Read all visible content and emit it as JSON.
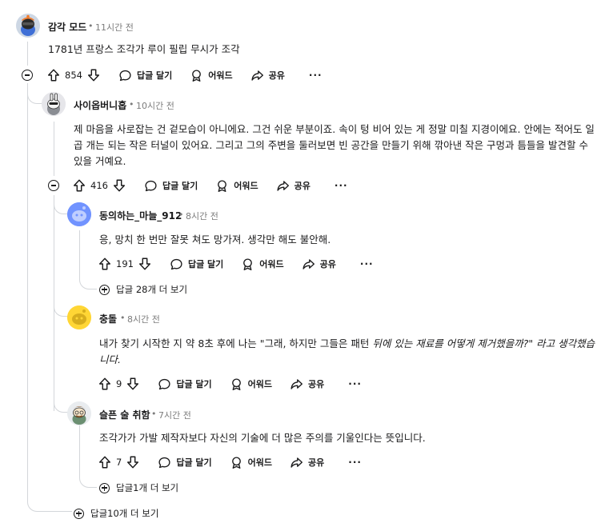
{
  "comments": [
    {
      "author": "감각 모드",
      "time": "11시간 전",
      "body": "1781년 프랑스 조각가 루이 필립 무시가 조각",
      "votes": "854",
      "actions": {
        "reply": "답글 달기",
        "award": "어워드",
        "share": "공유",
        "more": "···"
      }
    },
    {
      "author": "사이옵버니홉",
      "time": "10시간 전",
      "body": "제 마음을 사로잡는 건 겉모습이 아니에요. 그건 쉬운 부분이죠. 속이 텅 비어 있는 게 정말 미칠 지경이에요. 안에는 적어도 일곱 개는 되는 작은 터널이 있어요. 그리고 그의 주변을 둘러보면 빈 공간을 만들기 위해 깎아낸 작은 구멍과 틈들을 발견할 수 있을 거예요.",
      "votes": "416",
      "actions": {
        "reply": "답글 달기",
        "award": "어워드",
        "share": "공유",
        "more": "···"
      }
    },
    {
      "author": "동의하는_마늘_912",
      "time": "8시간 전",
      "body": "응, 망치 한 번만 잘못 쳐도 망가져. 생각만 해도 불안해.",
      "votes": "191",
      "actions": {
        "reply": "답글 달기",
        "award": "어워드",
        "share": "공유",
        "more": "···"
      },
      "more_replies": "답글 28개 더 보기"
    },
    {
      "author": "충돌",
      "time": "8시간 전",
      "body_prefix": "내가 찾기 시작한 지 약 8초 후에 나는 \"그래, 하지만 그들은 패턴 ",
      "body_italic": "뒤에 있는 재료를 어떻게 제거했을까?\" 라고 생각했습니다.",
      "votes": "9",
      "actions": {
        "reply": "답글 달기",
        "award": "어워드",
        "share": "공유",
        "more": "···"
      }
    },
    {
      "author": "슬픈 술 취함",
      "time": "7시간 전",
      "body": "조각가가 가발 제작자보다 자신의 기술에 더 많은 주의를 기울인다는 뜻입니다.",
      "votes": "7",
      "actions": {
        "reply": "답글 달기",
        "award": "어워드",
        "share": "공유",
        "more": "···"
      },
      "more_replies": "답글1개 더 보기"
    }
  ],
  "thread_more_replies": "답글10개 더 보기",
  "separator": "•",
  "colors": {
    "text": "#1a1a1b",
    "muted": "#7c7c7c",
    "thread_line": "#d3d6da",
    "snoo_blue": "#7193ff",
    "snoo_yellow": "#ffd635"
  }
}
